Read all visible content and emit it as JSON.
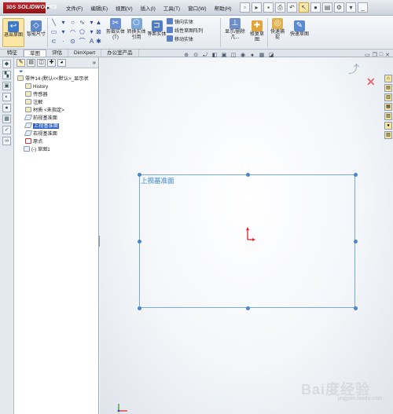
{
  "app": {
    "name": "SOLIDWORKS",
    "brand_prefix": "3DS"
  },
  "menu": [
    "文件(F)",
    "编辑(E)",
    "视图(V)",
    "插入(I)",
    "工具(T)",
    "窗口(W)",
    "帮助(H)"
  ],
  "ribbon": {
    "exit_sketch": "退出草图",
    "smart_dim": "智能尺寸",
    "cut_entities": "剪裁实体(T)",
    "convert_entities": "转换实体引用",
    "offset_entities": "等距实体",
    "mirror_entities": "镜向实体",
    "linear_pattern": "线性草图阵列",
    "move_entities": "移动实体",
    "display_relations": "显示/删除几...",
    "repair_sketch": "修复草图",
    "quick_snaps": "快速捕捉",
    "rapid_sketch": "快速草图"
  },
  "tabs": [
    "特征",
    "草图",
    "评估",
    "DimXpert",
    "办公室产品"
  ],
  "tree": {
    "part": "零件14 (默认<<默认>_显示状",
    "history": "History",
    "sensors": "传感器",
    "annotations": "注解",
    "material": "材质 <未指定>",
    "front_plane": "前视基准面",
    "top_plane": "上视基准面",
    "right_plane": "右视基准面",
    "origin": "原点",
    "sketch": "(-) 草图1"
  },
  "graphics": {
    "plane_label": "上视基准面"
  },
  "watermark": "Bai度经验",
  "watermark_sub": "jingyan.baidu.com",
  "colors": {
    "selection": "#3163c5",
    "plane": "#79abd9",
    "origin": "#d9232a",
    "brand": "#b31d24"
  }
}
